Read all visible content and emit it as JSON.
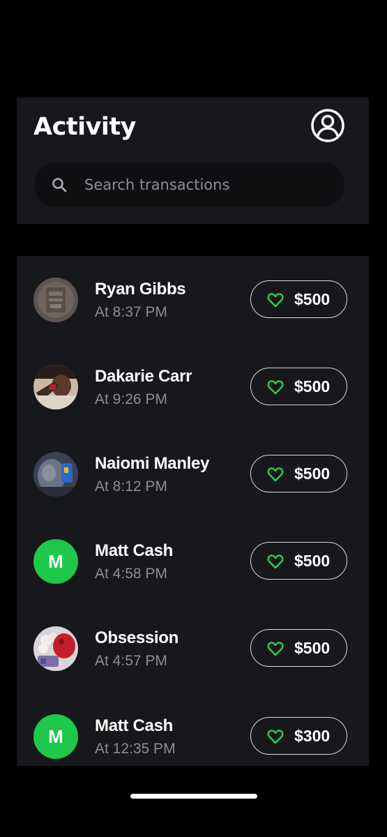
{
  "header": {
    "title": "Activity",
    "profile_icon": "user-circle-icon"
  },
  "search": {
    "placeholder": "Search transactions",
    "icon": "search-icon"
  },
  "colors": {
    "background": "#000000",
    "card": "#17181b",
    "accent_green": "#1ec84a",
    "heart_green": "#2ecc55",
    "muted_text": "#8c8d91"
  },
  "transactions": [
    {
      "name": "Ryan Gibbs",
      "time": "At 8:37 PM",
      "amount": "$500",
      "avatar": "photo",
      "icon": "heart-icon"
    },
    {
      "name": "Dakarie Carr",
      "time": "At 9:26 PM",
      "amount": "$500",
      "avatar": "photo",
      "icon": "heart-icon"
    },
    {
      "name": "Naiomi Manley",
      "time": "At 8:12 PM",
      "amount": "$500",
      "avatar": "photo",
      "icon": "heart-icon"
    },
    {
      "name": "Matt Cash",
      "time": "At 4:58 PM",
      "amount": "$500",
      "avatar": "letter",
      "initial": "M",
      "icon": "heart-icon"
    },
    {
      "name": "Obsession",
      "time": "At 4:57 PM",
      "amount": "$500",
      "avatar": "photo",
      "icon": "heart-icon"
    },
    {
      "name": "Matt Cash",
      "time": "At 12:35 PM",
      "amount": "$300",
      "avatar": "letter",
      "initial": "M",
      "icon": "heart-icon"
    }
  ]
}
